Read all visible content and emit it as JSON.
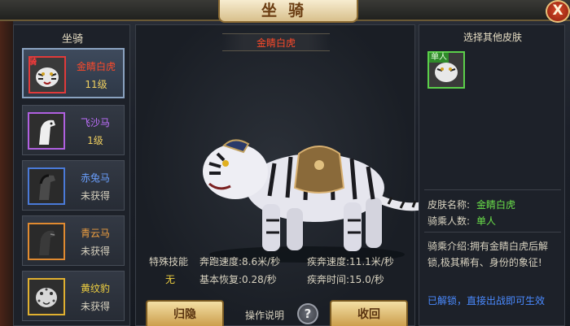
{
  "header": {
    "title": "坐骑",
    "close_label": "X"
  },
  "left": {
    "title": "坐骑",
    "mounts": [
      {
        "name": "金睛白虎",
        "status": "11级",
        "name_color": "#ff4a2a",
        "status_color": "#f0d060",
        "frame_color": "#e03a3a",
        "icon": "white-tiger-icon",
        "badge": "骑"
      },
      {
        "name": "飞沙马",
        "status": "1级",
        "name_color": "#c070ff",
        "status_color": "#f0d060",
        "frame_color": "#b060e0",
        "icon": "white-horse-icon"
      },
      {
        "name": "赤兔马",
        "status": "未获得",
        "name_color": "#6aa0ff",
        "status_color": "#d8d2c0",
        "frame_color": "#4a7ad8",
        "icon": "dark-horse-icon"
      },
      {
        "name": "青云马",
        "status": "未获得",
        "name_color": "#f0a040",
        "status_color": "#d8d2c0",
        "frame_color": "#e08a30",
        "icon": "black-horse-icon"
      },
      {
        "name": "黄纹豹",
        "status": "未获得",
        "name_color": "#f0d040",
        "status_color": "#d8d2c0",
        "frame_color": "#e0b030",
        "icon": "leopard-icon"
      }
    ]
  },
  "center": {
    "mount_name": "金睛白虎",
    "special_skill_label": "特殊技能",
    "special_skill_value": "无",
    "run_speed": "奔跑速度:8.6米/秒",
    "dash_speed": "疾奔速度:11.1米/秒",
    "base_recovery": "基本恢复:0.28/秒",
    "dash_time": "疾奔时间:15.0/秒",
    "return_button": "归隐",
    "help_label": "操作说明",
    "help_icon": "?",
    "recall_button": "收回"
  },
  "right": {
    "title": "选择其他皮肤",
    "skin_tag": "单人",
    "skin_name_label": "皮肤名称:",
    "skin_name_value": "金睛白虎",
    "riders_label": "骑乘人数:",
    "riders_value": "单人",
    "intro": "骑乘介绍:拥有金睛白虎后解锁,极其稀有、身份的象征!",
    "unlock_text": "已解锁，直接出战即可生效"
  },
  "colors": {
    "gold": "#c99a47",
    "red_name": "#ff4a2a",
    "green": "#6ae04a",
    "blue_text": "#4a8aff"
  }
}
